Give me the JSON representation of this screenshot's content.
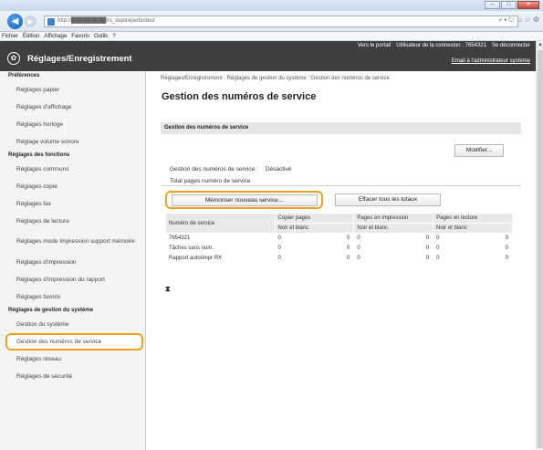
{
  "browser": {
    "url": "http://█████████/rs_deptreperbi/dest",
    "url_controls": "⌕ ▾ ↻",
    "window_controls": [
      "–",
      "□",
      "✕"
    ],
    "toolbar_icons": "⌂ ☆ ⚙",
    "menu": [
      "Fichier",
      "Édition",
      "Affichage",
      "Favoris",
      "Outils",
      "?"
    ]
  },
  "header": {
    "app_title": "Réglages/Enregistrement",
    "links": [
      "Vers le portail",
      "Utilisateur de la connexion : 7654321",
      "Se déconnecter"
    ],
    "admin_link": "Email à l'administrateur système"
  },
  "sidebar": {
    "sections": [
      {
        "title": "Préférences",
        "items": [
          "Réglages papier",
          "Réglages d'affichage",
          "Réglages horloge",
          "Réglage volume sonore"
        ]
      },
      {
        "title": "Réglages des fonctions",
        "items": [
          "Réglages communs",
          "Réglages copie",
          "Réglages fax",
          "Réglages de lecture",
          "Réglages mode Impression support mémoire",
          "Réglages d'impression",
          "Réglages d'impression du rapport",
          "Réglages favoris"
        ]
      },
      {
        "title": "Réglages de gestion du système",
        "items": [
          "Gestion du système",
          "Gestion des numéros de service",
          "Réglages réseau",
          "Réglages de sécurité"
        ]
      }
    ],
    "active_item": "Gestion des numéros de service"
  },
  "main": {
    "breadcrumb": "Réglages/Enregistrement : Réglages de gestion du système : Gestion des numéros de service",
    "page_title": "Gestion des numéros de service",
    "section_title": "Gestion des numéros de service",
    "modify_button": "Modifier...",
    "management_label": "Gestion des numéros de service :",
    "management_value": "Désactivé",
    "total_label": "Total pages numéro de service",
    "new_service_button": "Mémoriser nouveau service...",
    "clear_totals_button": "Effacer tous les totaux",
    "table": {
      "header_service": "Numéro de service",
      "groups": [
        "Copier pages",
        "Pages en impression",
        "Pages en lecture"
      ],
      "subheader": "Noir et blanc",
      "rows": [
        {
          "name": "7654321",
          "copy": "0",
          "copy_b": "0",
          "print": "0",
          "print_b": "0",
          "scan": "0",
          "scan_b": "0"
        },
        {
          "name": "Tâches sans num.",
          "copy": "0",
          "copy_b": "0",
          "print": "0",
          "print_b": "0",
          "scan": "0",
          "scan_b": "0"
        },
        {
          "name": "Rapport auto/impr RX",
          "copy": "0",
          "copy_b": "0",
          "print": "0",
          "print_b": "0",
          "scan": "0",
          "scan_b": "0"
        }
      ]
    },
    "bottom_icon": "⧗"
  }
}
